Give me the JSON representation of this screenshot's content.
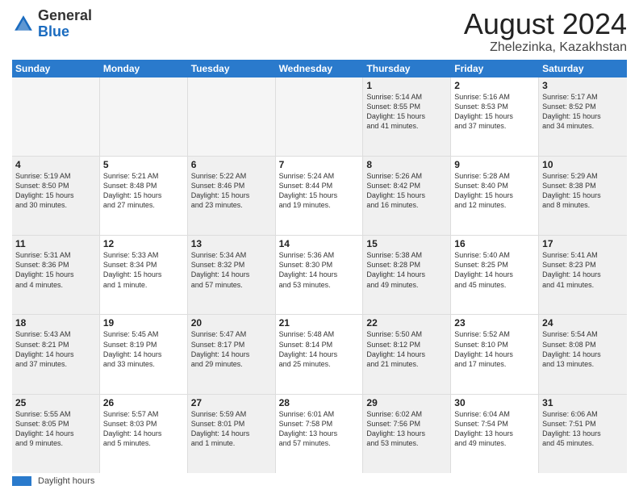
{
  "header": {
    "logo_general": "General",
    "logo_blue": "Blue",
    "month_year": "August 2024",
    "location": "Zhelezinka, Kazakhstan"
  },
  "days_of_week": [
    "Sunday",
    "Monday",
    "Tuesday",
    "Wednesday",
    "Thursday",
    "Friday",
    "Saturday"
  ],
  "weeks": [
    [
      {
        "day": "",
        "info": "",
        "empty": true
      },
      {
        "day": "",
        "info": "",
        "empty": true
      },
      {
        "day": "",
        "info": "",
        "empty": true
      },
      {
        "day": "",
        "info": "",
        "empty": true
      },
      {
        "day": "1",
        "info": "Sunrise: 5:14 AM\nSunset: 8:55 PM\nDaylight: 15 hours\nand 41 minutes.",
        "empty": false
      },
      {
        "day": "2",
        "info": "Sunrise: 5:16 AM\nSunset: 8:53 PM\nDaylight: 15 hours\nand 37 minutes.",
        "empty": false
      },
      {
        "day": "3",
        "info": "Sunrise: 5:17 AM\nSunset: 8:52 PM\nDaylight: 15 hours\nand 34 minutes.",
        "empty": false
      }
    ],
    [
      {
        "day": "4",
        "info": "Sunrise: 5:19 AM\nSunset: 8:50 PM\nDaylight: 15 hours\nand 30 minutes.",
        "empty": false
      },
      {
        "day": "5",
        "info": "Sunrise: 5:21 AM\nSunset: 8:48 PM\nDaylight: 15 hours\nand 27 minutes.",
        "empty": false
      },
      {
        "day": "6",
        "info": "Sunrise: 5:22 AM\nSunset: 8:46 PM\nDaylight: 15 hours\nand 23 minutes.",
        "empty": false
      },
      {
        "day": "7",
        "info": "Sunrise: 5:24 AM\nSunset: 8:44 PM\nDaylight: 15 hours\nand 19 minutes.",
        "empty": false
      },
      {
        "day": "8",
        "info": "Sunrise: 5:26 AM\nSunset: 8:42 PM\nDaylight: 15 hours\nand 16 minutes.",
        "empty": false
      },
      {
        "day": "9",
        "info": "Sunrise: 5:28 AM\nSunset: 8:40 PM\nDaylight: 15 hours\nand 12 minutes.",
        "empty": false
      },
      {
        "day": "10",
        "info": "Sunrise: 5:29 AM\nSunset: 8:38 PM\nDaylight: 15 hours\nand 8 minutes.",
        "empty": false
      }
    ],
    [
      {
        "day": "11",
        "info": "Sunrise: 5:31 AM\nSunset: 8:36 PM\nDaylight: 15 hours\nand 4 minutes.",
        "empty": false
      },
      {
        "day": "12",
        "info": "Sunrise: 5:33 AM\nSunset: 8:34 PM\nDaylight: 15 hours\nand 1 minute.",
        "empty": false
      },
      {
        "day": "13",
        "info": "Sunrise: 5:34 AM\nSunset: 8:32 PM\nDaylight: 14 hours\nand 57 minutes.",
        "empty": false
      },
      {
        "day": "14",
        "info": "Sunrise: 5:36 AM\nSunset: 8:30 PM\nDaylight: 14 hours\nand 53 minutes.",
        "empty": false
      },
      {
        "day": "15",
        "info": "Sunrise: 5:38 AM\nSunset: 8:28 PM\nDaylight: 14 hours\nand 49 minutes.",
        "empty": false
      },
      {
        "day": "16",
        "info": "Sunrise: 5:40 AM\nSunset: 8:25 PM\nDaylight: 14 hours\nand 45 minutes.",
        "empty": false
      },
      {
        "day": "17",
        "info": "Sunrise: 5:41 AM\nSunset: 8:23 PM\nDaylight: 14 hours\nand 41 minutes.",
        "empty": false
      }
    ],
    [
      {
        "day": "18",
        "info": "Sunrise: 5:43 AM\nSunset: 8:21 PM\nDaylight: 14 hours\nand 37 minutes.",
        "empty": false
      },
      {
        "day": "19",
        "info": "Sunrise: 5:45 AM\nSunset: 8:19 PM\nDaylight: 14 hours\nand 33 minutes.",
        "empty": false
      },
      {
        "day": "20",
        "info": "Sunrise: 5:47 AM\nSunset: 8:17 PM\nDaylight: 14 hours\nand 29 minutes.",
        "empty": false
      },
      {
        "day": "21",
        "info": "Sunrise: 5:48 AM\nSunset: 8:14 PM\nDaylight: 14 hours\nand 25 minutes.",
        "empty": false
      },
      {
        "day": "22",
        "info": "Sunrise: 5:50 AM\nSunset: 8:12 PM\nDaylight: 14 hours\nand 21 minutes.",
        "empty": false
      },
      {
        "day": "23",
        "info": "Sunrise: 5:52 AM\nSunset: 8:10 PM\nDaylight: 14 hours\nand 17 minutes.",
        "empty": false
      },
      {
        "day": "24",
        "info": "Sunrise: 5:54 AM\nSunset: 8:08 PM\nDaylight: 14 hours\nand 13 minutes.",
        "empty": false
      }
    ],
    [
      {
        "day": "25",
        "info": "Sunrise: 5:55 AM\nSunset: 8:05 PM\nDaylight: 14 hours\nand 9 minutes.",
        "empty": false
      },
      {
        "day": "26",
        "info": "Sunrise: 5:57 AM\nSunset: 8:03 PM\nDaylight: 14 hours\nand 5 minutes.",
        "empty": false
      },
      {
        "day": "27",
        "info": "Sunrise: 5:59 AM\nSunset: 8:01 PM\nDaylight: 14 hours\nand 1 minute.",
        "empty": false
      },
      {
        "day": "28",
        "info": "Sunrise: 6:01 AM\nSunset: 7:58 PM\nDaylight: 13 hours\nand 57 minutes.",
        "empty": false
      },
      {
        "day": "29",
        "info": "Sunrise: 6:02 AM\nSunset: 7:56 PM\nDaylight: 13 hours\nand 53 minutes.",
        "empty": false
      },
      {
        "day": "30",
        "info": "Sunrise: 6:04 AM\nSunset: 7:54 PM\nDaylight: 13 hours\nand 49 minutes.",
        "empty": false
      },
      {
        "day": "31",
        "info": "Sunrise: 6:06 AM\nSunset: 7:51 PM\nDaylight: 13 hours\nand 45 minutes.",
        "empty": false
      }
    ]
  ],
  "footer": {
    "label": "Daylight hours"
  }
}
